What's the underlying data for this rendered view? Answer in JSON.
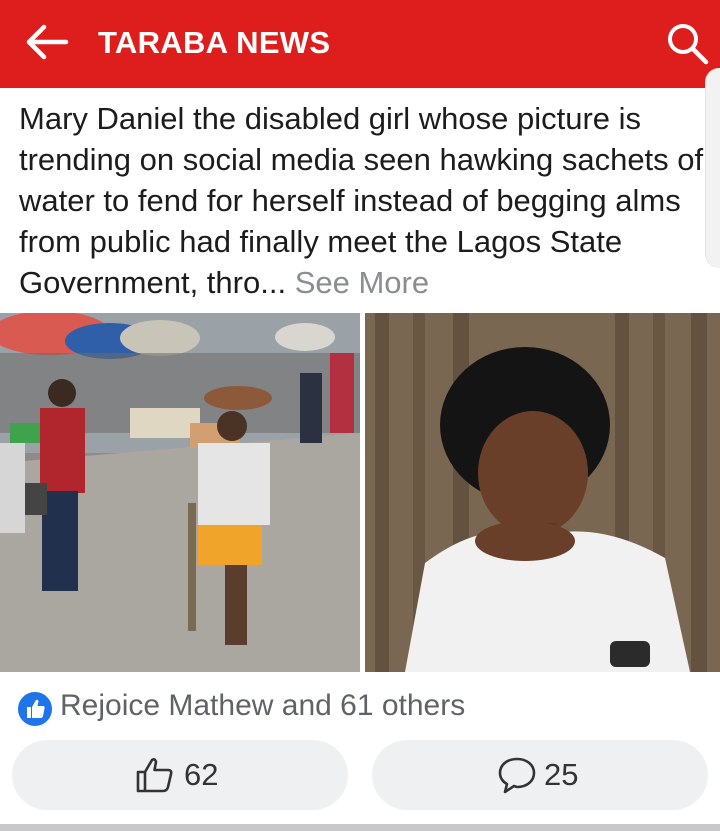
{
  "header": {
    "title": "TARABA NEWS",
    "back_icon": "arrow-left-icon",
    "search_icon": "search-icon",
    "background": "#de1d1d"
  },
  "post": {
    "text": "Mary Daniel the disabled girl whose picture is trending on social media seen hawking sachets of water to fend for herself instead of begging alms from public had finally meet the Lagos State Government, thro...",
    "see_more": "See More",
    "photos": [
      {
        "description_icon": "street-market-photo"
      },
      {
        "description_icon": "portrait-photo"
      }
    ]
  },
  "reactions": {
    "summary": "Rejoice Mathew and 61 others",
    "icon": "thumbs-up-badge-icon",
    "badge_color": "#1e74e8"
  },
  "actions": {
    "like_count": "62",
    "comment_count": "25"
  }
}
